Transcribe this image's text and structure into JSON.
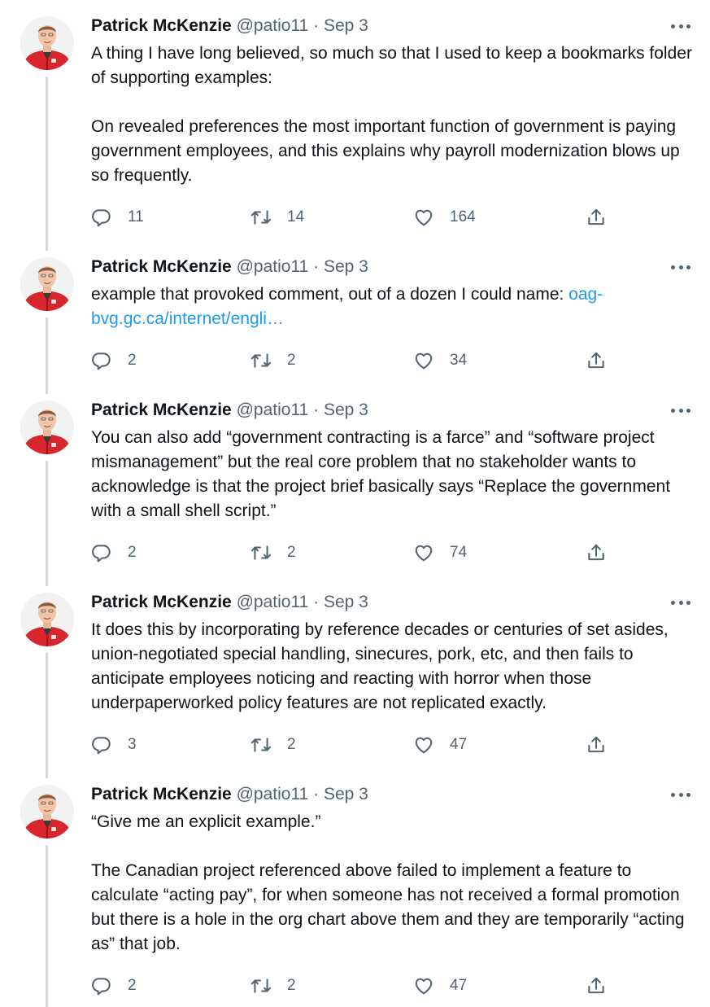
{
  "thread": {
    "tweets": [
      {
        "author": "Patrick McKenzie",
        "handle": "@patio11",
        "separator": "·",
        "date": "Sep 3",
        "text": "A thing I have long believed, so much so that I used to keep a bookmarks folder of supporting examples:\n\nOn revealed preferences the most important function of government is paying government employees, and this explains why payroll modernization blows up so frequently.",
        "link": "",
        "replies": "11",
        "retweets": "14",
        "likes": "164"
      },
      {
        "author": "Patrick McKenzie",
        "handle": "@patio11",
        "separator": "·",
        "date": "Sep 3",
        "text": "example that provoked comment, out of a dozen I could name: ",
        "link": "oag-\nbvg.gc.ca/internet/engli…",
        "replies": "2",
        "retweets": "2",
        "likes": "34"
      },
      {
        "author": "Patrick McKenzie",
        "handle": "@patio11",
        "separator": "·",
        "date": "Sep 3",
        "text": "You can also add “government contracting is a farce” and “software project mismanagement” but the real core problem that no stakeholder wants to acknowledge is that the project brief basically says “Replace the government with a small shell script.”",
        "link": "",
        "replies": "2",
        "retweets": "2",
        "likes": "74"
      },
      {
        "author": "Patrick McKenzie",
        "handle": "@patio11",
        "separator": "·",
        "date": "Sep 3",
        "text": "It does this by incorporating by reference decades or centuries of set asides, union-negotiated special handling, sinecures, pork, etc, and then fails to anticipate employees noticing and reacting with horror when those underpaperworked policy features are not replicated exactly.",
        "link": "",
        "replies": "3",
        "retweets": "2",
        "likes": "47"
      },
      {
        "author": "Patrick McKenzie",
        "handle": "@patio11",
        "separator": "·",
        "date": "Sep 3",
        "text": "“Give me an explicit example.”\n\nThe Canadian project referenced above failed to implement a feature to calculate “acting pay”, for when someone has not received a formal promotion but there is a hole in the org chart above them and they are temporarily “acting as” that job.",
        "link": "",
        "replies": "2",
        "retweets": "2",
        "likes": "47"
      }
    ]
  },
  "icons": {
    "reply": "reply-icon",
    "retweet": "retweet-icon",
    "like": "like-icon",
    "share": "share-icon",
    "more": "more-icon"
  },
  "colors": {
    "text": "#0f1419",
    "secondary": "#536471",
    "link": "#1d9bf0",
    "thread_line": "#cfd9de",
    "avatar_jacket": "#d9262c"
  }
}
